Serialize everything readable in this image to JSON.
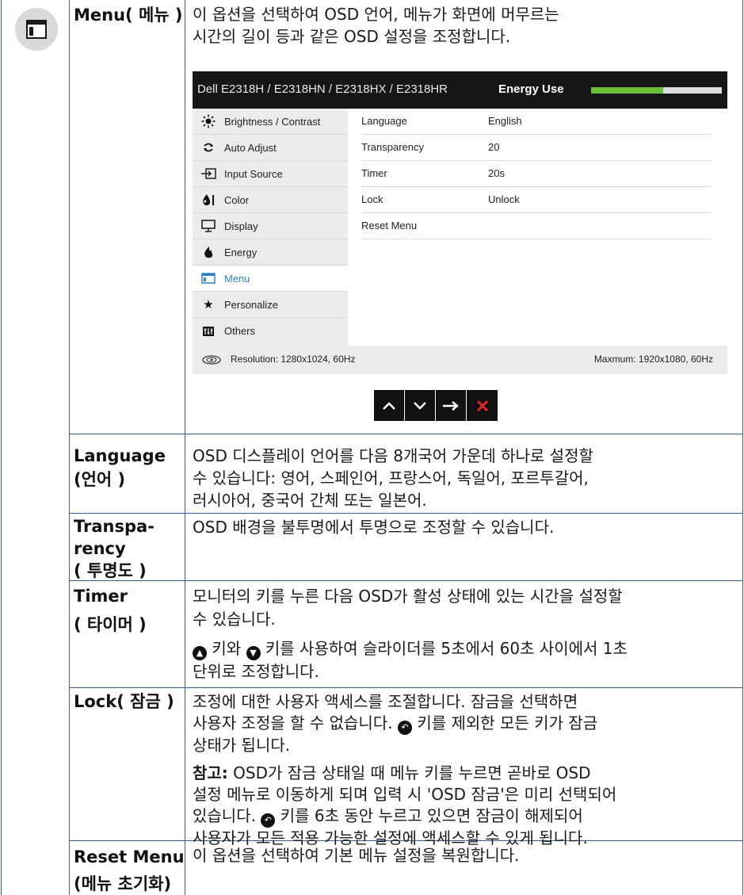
{
  "menu_row": {
    "label": "Menu( 메뉴 )",
    "desc_line1": "이 옵션을 선택하여 OSD 언어, 메뉴가 화면에 머무르는",
    "desc_line2": "시간의 길이 등과 같은 OSD 설정을 조정합니다."
  },
  "osd": {
    "model": "Dell E2318H / E2318HN / E2318HX / E2318HR",
    "energy_label": "Energy Use",
    "energy_level": 0.55,
    "sidebar": [
      {
        "label": "Brightness / Contrast",
        "icon": "brightness-icon"
      },
      {
        "label": "Auto Adjust",
        "icon": "auto-adjust-icon"
      },
      {
        "label": "Input Source",
        "icon": "input-source-icon"
      },
      {
        "label": "Color",
        "icon": "color-icon"
      },
      {
        "label": "Display",
        "icon": "display-icon"
      },
      {
        "label": "Energy",
        "icon": "energy-icon"
      },
      {
        "label": "Menu",
        "icon": "menu-icon"
      },
      {
        "label": "Personalize",
        "icon": "star-icon"
      },
      {
        "label": "Others",
        "icon": "others-icon"
      }
    ],
    "options": [
      {
        "name": "Language",
        "value": "English"
      },
      {
        "name": "Transparency",
        "value": "20"
      },
      {
        "name": "Timer",
        "value": "20s"
      },
      {
        "name": "Lock",
        "value": "Unlock"
      },
      {
        "name": "Reset Menu",
        "value": ""
      }
    ],
    "resolution": "Resolution: 1280x1024, 60Hz",
    "max_resolution": "Maxmum: 1920x1080, 60Hz",
    "accent_color": "#2f82c8",
    "energy_color": "#6abf3a"
  },
  "rows": {
    "language": {
      "label1": "Language",
      "label2": "(언어 )",
      "line1": "OSD 디스플레이 언어를 다음 8개국어 가운데 하나로 설정할",
      "line2": "수 있습니다: 영어, 스페인어, 프랑스어, 독일어, 포르투갈어,",
      "line3": "러시아어, 중국어 간체 또는 일본어."
    },
    "transparency": {
      "label1": "Transpa-",
      "label2": "rency",
      "label3": "( 투명도 )",
      "line1": "OSD 배경을 불투명에서 투명으로 조정할 수 있습니다."
    },
    "timer": {
      "label1": "Timer",
      "label2": "( 타이머 )",
      "line1": "모니터의 키를 누른 다음 OSD가 활성 상태에 있는 시간을 설정할",
      "line2": "수 있습니다.",
      "line3": "키와",
      "line3b": "키를 사용하여 슬라이더를 5초에서 60초 사이에서 1초",
      "line4": "단위로 조정합니다."
    },
    "lock": {
      "label": "Lock( 잠금 )",
      "line1": "조정에 대한 사용자 액세스를 조절합니다. 잠금을 선택하면",
      "line2": "사용자 조정을 할 수 없습니다.",
      "line2b": "키를 제외한 모든 키가 잠금",
      "line3": "상태가 됩니다.",
      "note_label": "참고:",
      "note1": "OSD가 잠금 상태일 때 메뉴 키를 누르면 곧바로 OSD",
      "note2": "설정 메뉴로 이동하게 되며 입력 시 'OSD 잠금'은 미리 선택되어",
      "note3": "있습니다.",
      "note3b": "키를 6초 동안 누르고 있으면 잠금이 해제되어",
      "note4": "사용자가 모든 적용 가능한 설정에 액세스할 수 있게 됩니다."
    },
    "reset": {
      "label1": "Reset Menu",
      "label2": "(메뉴 초기화)",
      "line1": "이 옵션을 선택하여 기본 메뉴 설정을 복원합니다."
    }
  }
}
